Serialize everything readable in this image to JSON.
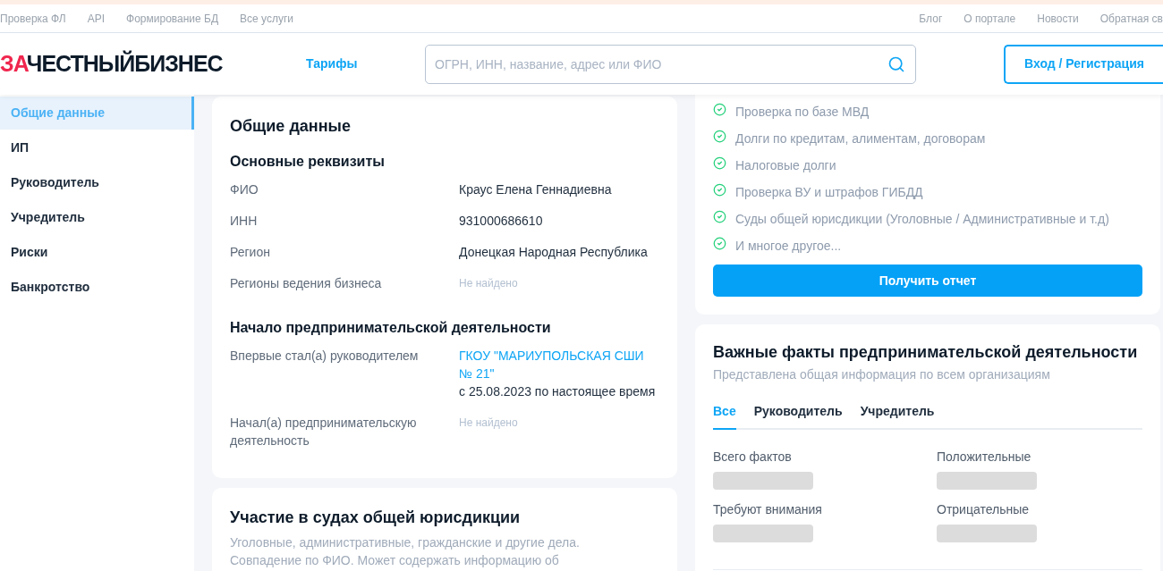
{
  "top_nav": {
    "left": [
      "Проверка ФЛ",
      "API",
      "Формирование БД",
      "Все услуги"
    ],
    "right": [
      "Блог",
      "О портале",
      "Новости",
      "Обратная св"
    ]
  },
  "header": {
    "logo": {
      "accent": "ЗА",
      "rest": "ЧЕСТНЫЙБИЗНЕС"
    },
    "tariffs": "Тарифы",
    "search": {
      "placeholder": "ОГРН, ИНН, название, адрес или ФИО"
    },
    "login": "Вход / Регистрация"
  },
  "sidebar": {
    "items": [
      {
        "label": "Общие данные",
        "selected": true
      },
      {
        "label": "ИП",
        "selected": false
      },
      {
        "label": "Руководитель",
        "selected": false
      },
      {
        "label": "Учредитель",
        "selected": false
      },
      {
        "label": "Риски",
        "selected": false
      },
      {
        "label": "Банкротство",
        "selected": false
      }
    ]
  },
  "general": {
    "title": "Общие данные",
    "sections": [
      {
        "title": "Основные реквизиты",
        "rows": [
          {
            "label": "ФИО",
            "kind": "text",
            "value": "Краус Елена Геннадиевна"
          },
          {
            "label": "ИНН",
            "kind": "text",
            "value": "931000686610"
          },
          {
            "label": "Регион",
            "kind": "text",
            "value": "Донецкая Народная Республика"
          },
          {
            "label": "Регионы ведения бизнеса",
            "kind": "missing",
            "value": "Не найдено"
          }
        ]
      },
      {
        "title": "Начало предпринимательской деятельности",
        "rows": [
          {
            "label": "Впервые стал(а) руководителем",
            "kind": "link",
            "value": "ГКОУ \"МАРИУПОЛЬСКАЯ СШИ № 21\"",
            "note": "с 25.08.2023 по настоящее время"
          },
          {
            "label": "Начал(а) предпринимательскую деятельность",
            "kind": "missing",
            "value": "Не найдено"
          }
        ]
      }
    ]
  },
  "courts": {
    "title": "Участие в судах общей юрисдикции",
    "description_lines": [
      "Уголовные, административные, гражданские и другие дела.",
      "Совпадение по ФИО. Может содержать информацию об"
    ]
  },
  "report": {
    "items": [
      "Проверка по базе МВД",
      "Долги по кредитам, алиментам, договорам",
      "Налоговые долги",
      "Проверка ВУ и штрафов ГИБДД",
      "Суды общей юрисдикции  (Уголовные / Административные и т.д)",
      "И многое другое..."
    ],
    "button": "Получить отчет"
  },
  "facts": {
    "title": "Важные факты предпринимательской деятельности",
    "subtitle": "Представлена общая информация по всем организациям",
    "tabs": [
      {
        "label": "Все",
        "selected": true
      },
      {
        "label": "Руководитель",
        "selected": false
      },
      {
        "label": "Учредитель",
        "selected": false
      }
    ],
    "stats": [
      {
        "label": "Всего фактов"
      },
      {
        "label": "Положительные"
      },
      {
        "label": "Требуют внимания"
      },
      {
        "label": "Отрицательные"
      }
    ]
  }
}
